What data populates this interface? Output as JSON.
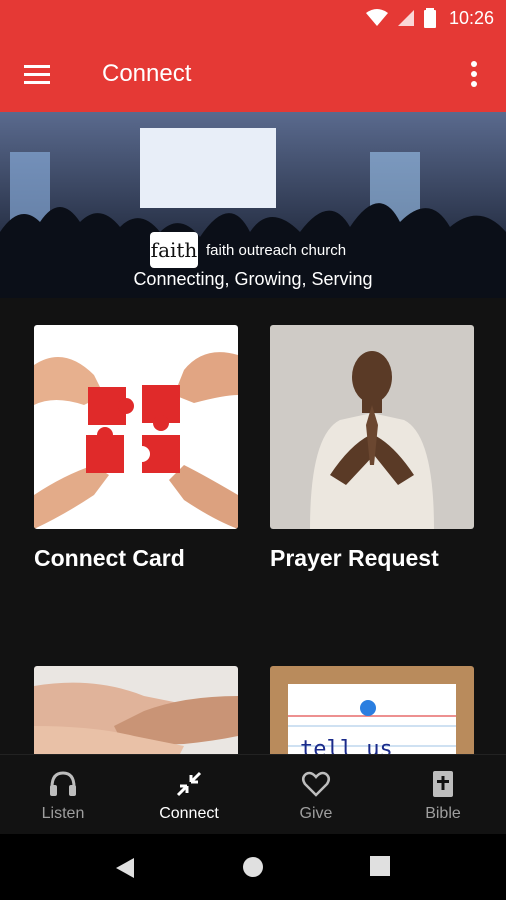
{
  "status": {
    "time": "10:26"
  },
  "appbar": {
    "title": "Connect"
  },
  "hero": {
    "church_name": "faith outreach church",
    "tagline": "Connecting, Growing, Serving",
    "logo_text": "faith"
  },
  "cards": [
    {
      "label": "Connect Card"
    },
    {
      "label": "Prayer Request"
    },
    {
      "label": ""
    },
    {
      "label": ""
    }
  ],
  "bottom_nav": [
    {
      "label": "Listen",
      "icon": "headphones-icon"
    },
    {
      "label": "Connect",
      "icon": "connect-icon"
    },
    {
      "label": "Give",
      "icon": "heart-icon"
    },
    {
      "label": "Bible",
      "icon": "bible-icon"
    }
  ],
  "colors": {
    "accent": "#e53935",
    "background": "#121212"
  }
}
